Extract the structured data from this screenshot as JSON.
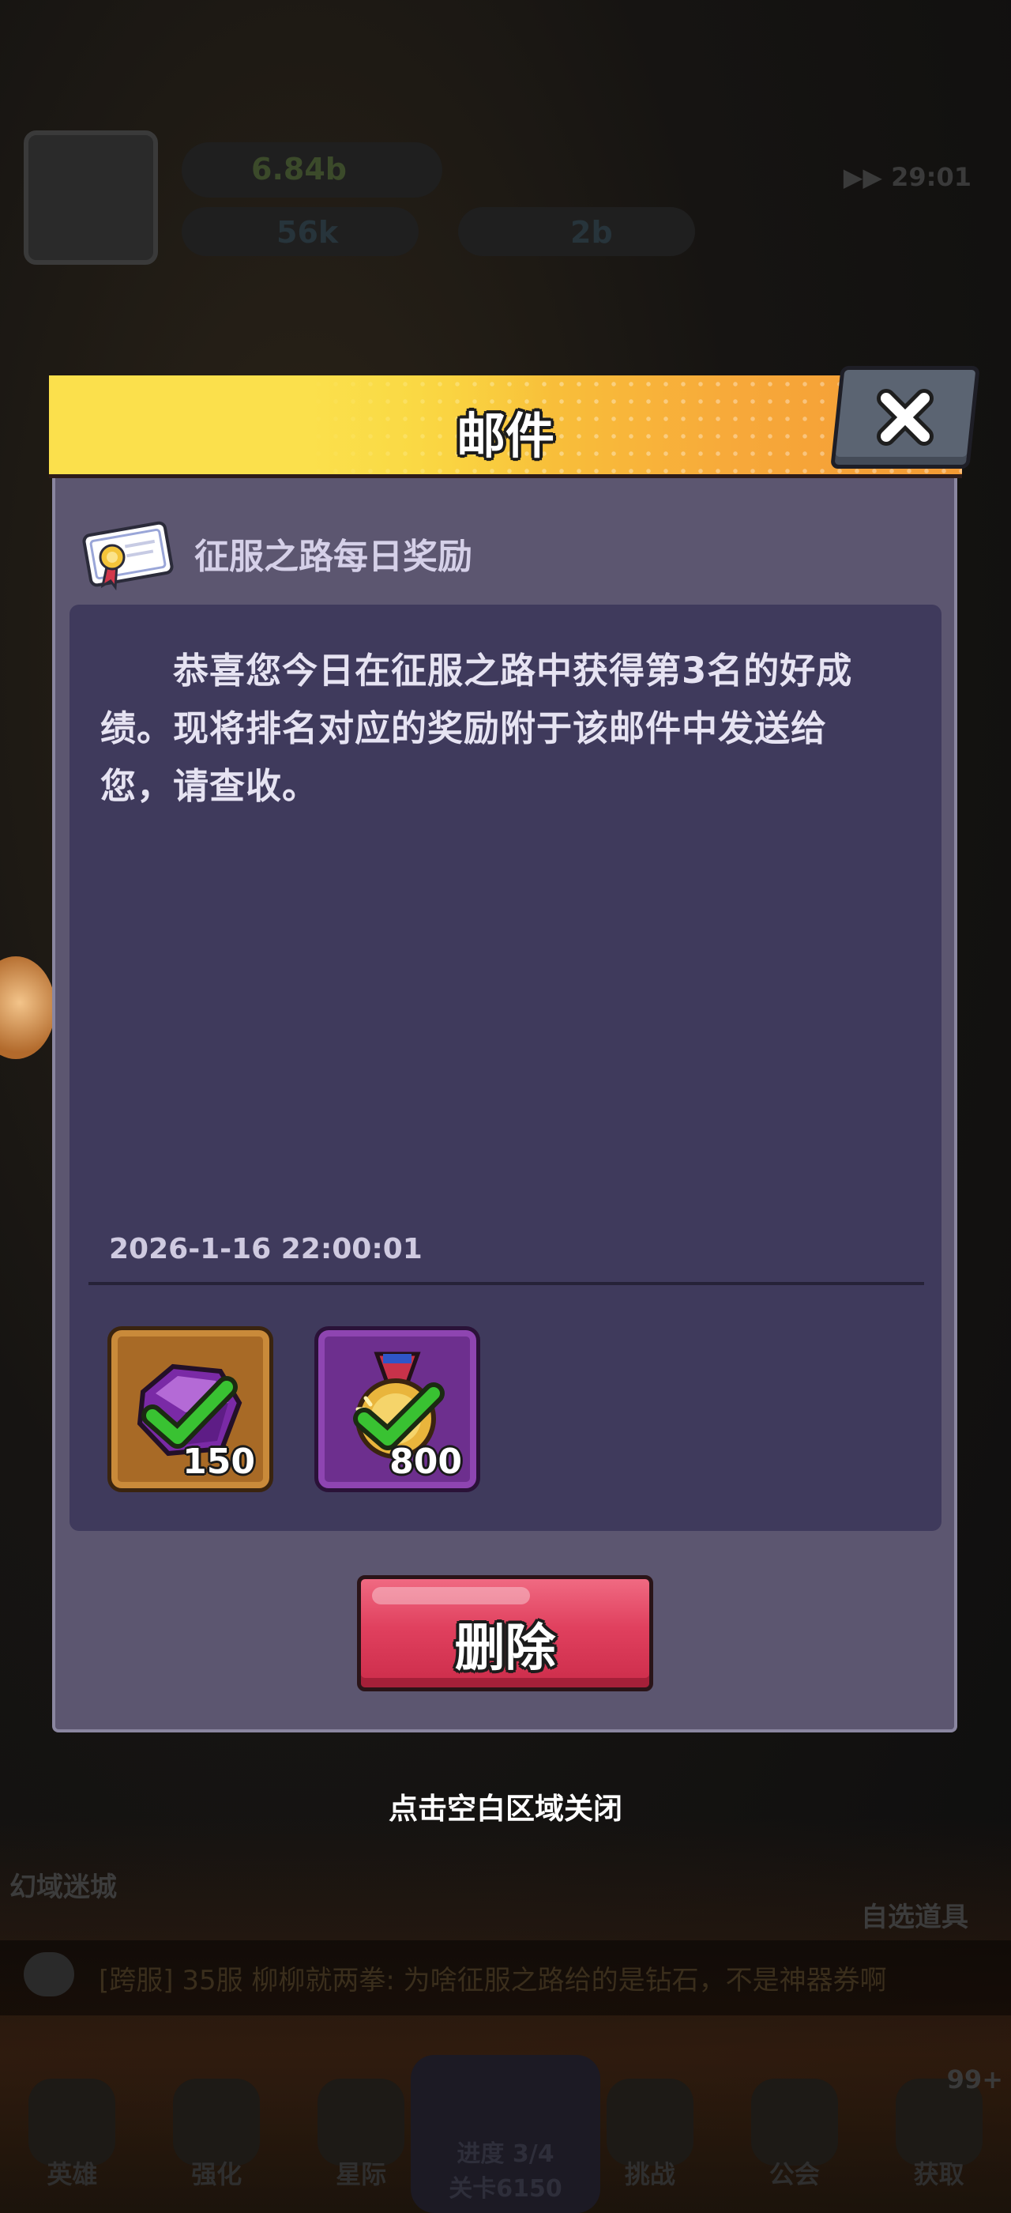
{
  "background": {
    "hud": {
      "power_value": "6.84b",
      "timer": "29:01",
      "resource_1": "56k",
      "resource_2": "2b"
    },
    "side_labels": {
      "left_bottom": "幻域迷城",
      "right_bottom": "自选道具"
    },
    "chat": {
      "text": "[跨服] 35服 柳柳就两拳: 为啥征服之路给的是钻石，不是神器券啊"
    },
    "nav": {
      "items": [
        "英雄",
        "强化",
        "星际",
        "进度 3/4",
        "挑战",
        "公会",
        "获取"
      ],
      "center_sub": "关卡6150",
      "badge": "99+"
    }
  },
  "dialog": {
    "title": "邮件",
    "close_icon": "close-x-icon",
    "mail": {
      "icon": "certificate-icon",
      "subject": "征服之路每日奖励",
      "body": "恭喜您今日在征服之路中获得第3名的好成绩。现将排名对应的奖励附于该邮件中发送给您，请查收。",
      "date": "2026-1-16 22:00:01"
    },
    "rewards": [
      {
        "icon": "purple-gem-icon",
        "count": "150",
        "claimed": true
      },
      {
        "icon": "gold-medal-icon",
        "count": "800",
        "claimed": true
      }
    ],
    "delete_button": "删除",
    "close_hint": "点击空白区域关闭"
  },
  "colors": {
    "header_yellow": "#fbe04c",
    "header_orange": "#f39a34",
    "dialog_bg": "#5c5670",
    "panel_bg": "#3f3a5c",
    "delete_red": "#e0405e",
    "check_green": "#39c232"
  }
}
